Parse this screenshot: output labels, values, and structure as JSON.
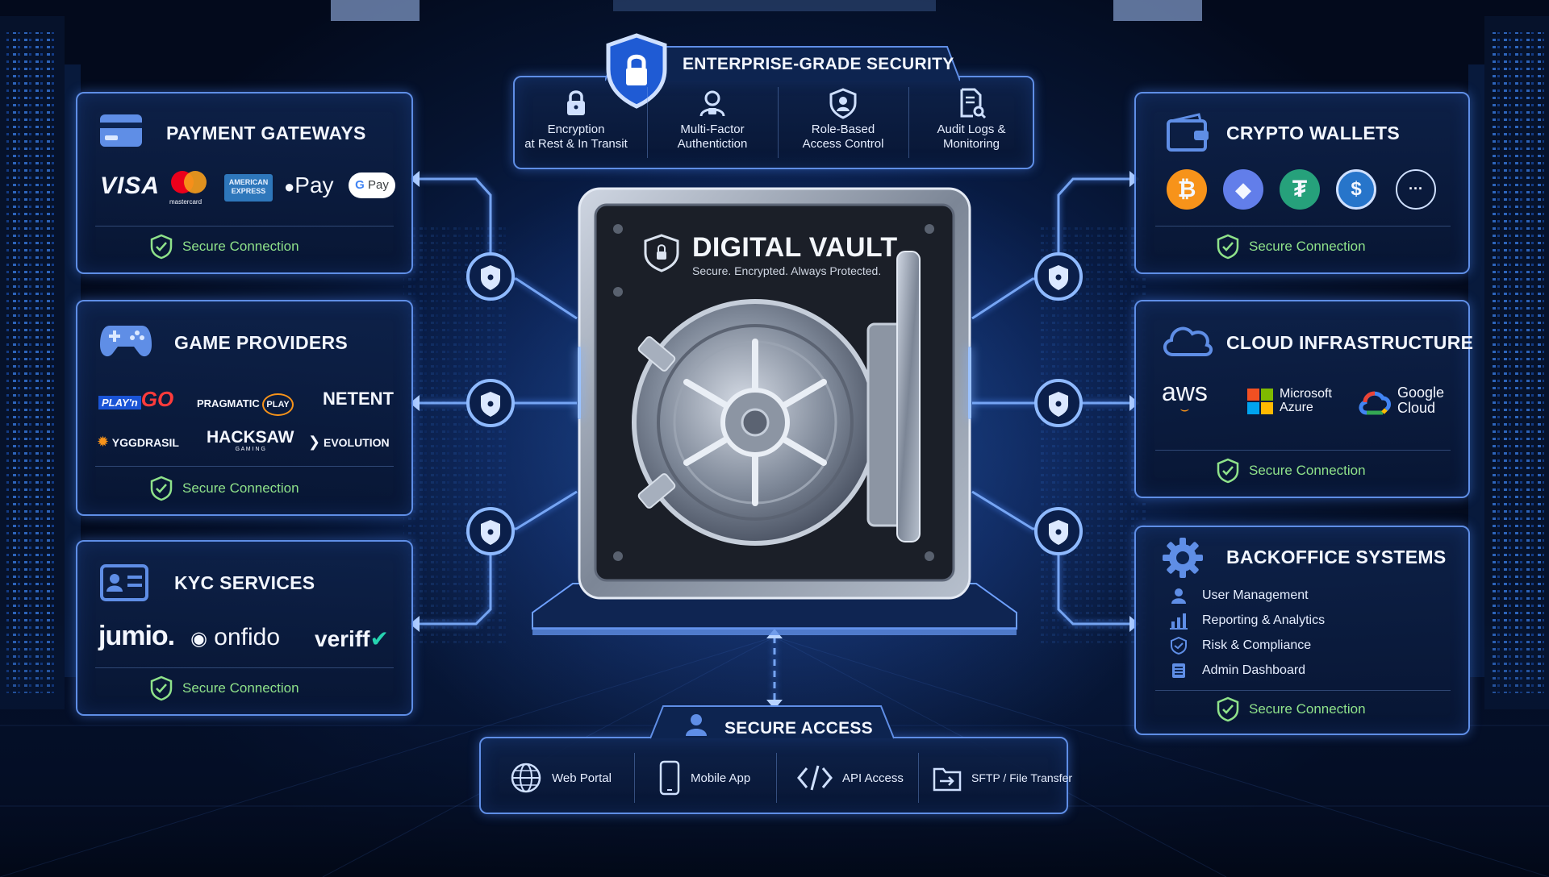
{
  "colors": {
    "accent": "#5f8ee6",
    "glow": "#7fb0ff",
    "secure_green": "#8fe28a",
    "bitcoin": "#f7931a",
    "ethereum": "#627eea",
    "tether": "#26a17b",
    "usdc": "#2775ca"
  },
  "security": {
    "title": "ENTERPRISE-GRADE SECURITY",
    "features": [
      {
        "icon": "padlock-icon",
        "line1": "Encryption",
        "line2": "at Rest & In Transit"
      },
      {
        "icon": "user-lock-icon",
        "line1": "Multi-Factor",
        "line2": "Authentiction"
      },
      {
        "icon": "user-shield-icon",
        "line1": "Role-Based",
        "line2": "Access Control"
      },
      {
        "icon": "document-search-icon",
        "line1": "Audit Logs &",
        "line2": "Monitoring"
      }
    ]
  },
  "vault": {
    "title": "DIGITAL VAULT",
    "subtitle": "Secure. Encrypted. Always Protected."
  },
  "payment": {
    "title": "PAYMENT GATEWAYS",
    "visa": "VISA",
    "mastercard": "mastercard",
    "amex_line1": "AMERICAN",
    "amex_line2": "EXPRESS",
    "applepay": "Pay",
    "gpay": "Pay",
    "secure": "Secure Connection"
  },
  "games": {
    "title": "GAME PROVIDERS",
    "playngo_a": "PLAY'n",
    "playngo_b": "GO",
    "pragmatic": "PRAGMATIC",
    "pragmatic_play": "PLAY",
    "netent": "NETENT",
    "yggdrasil": "YGGDRASIL",
    "hacksaw": "HACKSAW",
    "hacksaw_sub": "G A M I N G",
    "evolution": "EVOLUTION",
    "secure": "Secure Connection"
  },
  "kyc": {
    "title": "KYC SERVICES",
    "jumio": "jumio.",
    "onfido": "onfido",
    "veriff": "veriff",
    "secure": "Secure Connection"
  },
  "crypto": {
    "title": "CRYPTO WALLETS",
    "coins": [
      {
        "icon": "bitcoin-icon",
        "glyph": "₿"
      },
      {
        "icon": "ethereum-icon",
        "glyph": "◆"
      },
      {
        "icon": "tether-icon",
        "glyph": "₮"
      },
      {
        "icon": "usdc-icon",
        "glyph": "$"
      },
      {
        "icon": "more-icon",
        "glyph": "···"
      }
    ],
    "secure": "Secure Connection"
  },
  "cloud": {
    "title": "CLOUD INFRASTRUCTURE",
    "aws": "aws",
    "ms_line1": "Microsoft",
    "ms_line2": "Azure",
    "google_line1": "Google",
    "google_line2": "Cloud",
    "secure": "Secure Connection"
  },
  "backoffice": {
    "title": "BACKOFFICE SYSTEMS",
    "items": [
      {
        "icon": "user-icon",
        "label": "User Management"
      },
      {
        "icon": "bar-chart-icon",
        "label": "Reporting & Analytics"
      },
      {
        "icon": "shield-check-icon",
        "label": "Risk & Compliance"
      },
      {
        "icon": "list-icon",
        "label": "Admin Dashboard"
      }
    ],
    "secure": "Secure Connection"
  },
  "access": {
    "title": "SECURE ACCESS",
    "items": [
      {
        "icon": "globe-icon",
        "label": "Web Portal"
      },
      {
        "icon": "phone-icon",
        "label": "Mobile App"
      },
      {
        "icon": "code-icon",
        "label": "API Access"
      },
      {
        "icon": "file-transfer-icon",
        "label": "SFTP / File Transfer"
      }
    ]
  }
}
